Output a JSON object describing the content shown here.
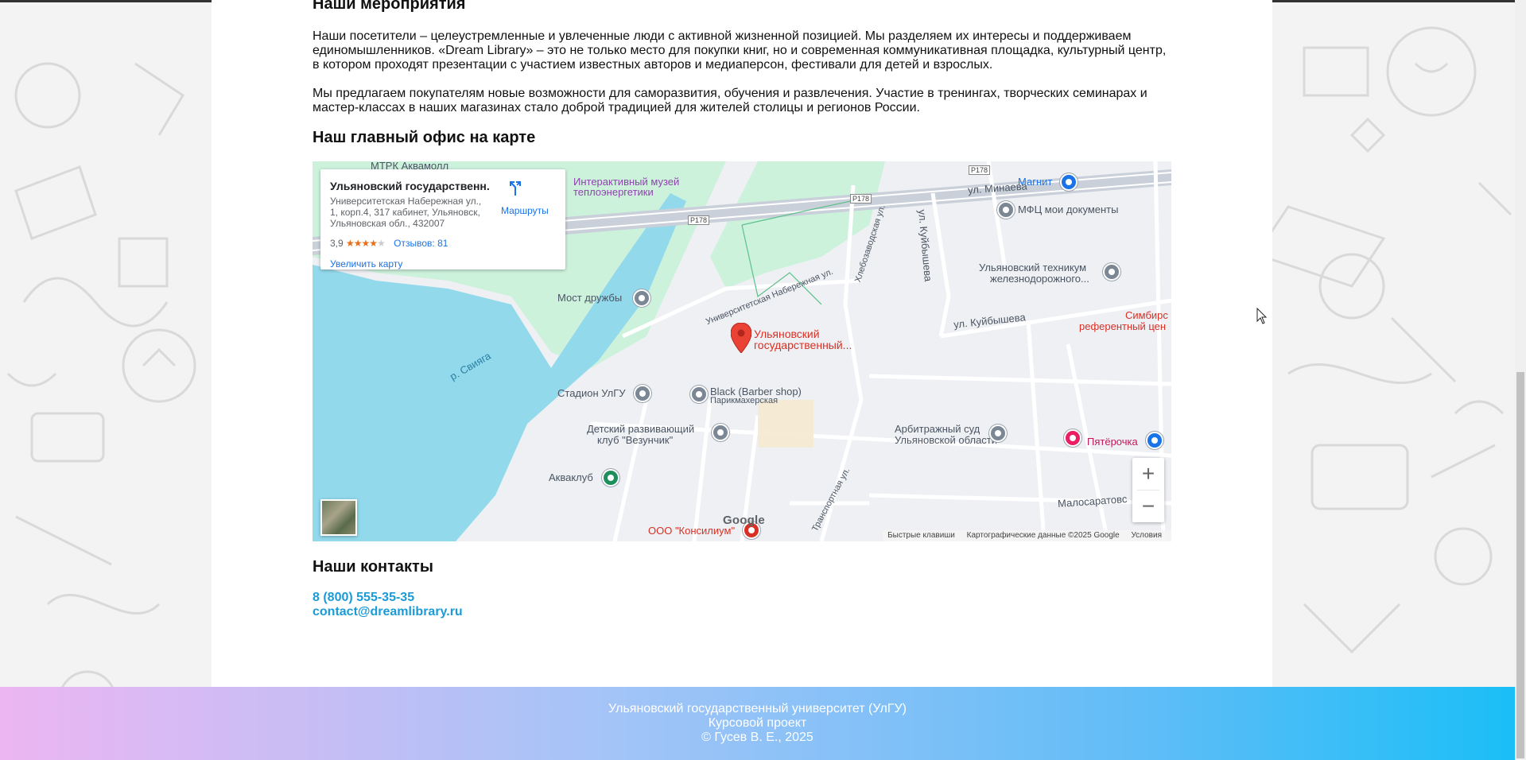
{
  "events": {
    "heading": "Наши мероприятия",
    "paragraph1_line1": "Наши посетители – целеустремленные и увлеченные люди с активной жизненной позицией. Мы разделяем их интересы и поддерживаем",
    "paragraph1_line2": "единомышленников. «Dream Library» – это не только место для покупки книг, но и современная коммуникативная площадка, культурный центр,",
    "paragraph1_line3": "в котором проходят презентации с участием известных авторов и медиаперсон, фестивали для детей и взрослых.",
    "paragraph2_line1": "Мы предлагаем покупателям новые возможности для саморазвития, обучения и развлечения. Участие в тренингах, творческих семинарах и",
    "paragraph2_line2": "мастер-классах в наших магазинах стало доброй традицией для жителей столицы и регионов России."
  },
  "office": {
    "heading": "Наш главный офис на карте"
  },
  "map": {
    "place_title": "Ульяновский государственн...",
    "address_line1": "Университетская Набережная ул.,",
    "address_line2": "1, корп.4, 317 кабинет, Ульяновск,",
    "address_line3": "Ульяновская обл., 432007",
    "rating": "3,9",
    "stars_on": "★★★★",
    "stars_off": "★",
    "reviews": "Отзывов: 81",
    "enlarge": "Увеличить карту",
    "directions": "Маршруты",
    "marker_label_line1": "Ульяновский",
    "marker_label_line2": "государственный...",
    "labels": {
      "akvamoll": "МТРК Аквамолл",
      "museum_line1": "Интерактивный музей",
      "museum_line2": "теплоэнергетики",
      "minaeva": "ул. Минаева",
      "magnit": "Магнит",
      "mfc": "МФЦ мои документы",
      "tech_line1": "Ульяновский техникум",
      "tech_line2": "железнодорожного...",
      "most": "Мост дружбы",
      "kuibysheva1": "ул. Куйбышева",
      "kuibysheva2": "ул. Куйбышева",
      "simbirsk_line1": "Симбирс",
      "simbirsk_line2": "референтный цен",
      "sviyaga": "р. Свияга",
      "univ_nab": "Университетская Набережная ул.",
      "khlebozav": "Хлебозаводская ул.",
      "stadium": "Стадион УлГУ",
      "barber_line1": "Black (Barber shop)",
      "barber_line2": "Парикмахерская",
      "kids_line1": "Детский развивающий",
      "kids_line2": "клуб \"Везунчик\"",
      "arbitr_line1": "Арбитражный суд",
      "arbitr_line2": "Ульяновской области",
      "pyaterochka": "Пятёрочка",
      "akvaklub": "Акваклуб",
      "transport": "Транспортная ул.",
      "malosarat": "Малосаратовс",
      "konsilium": "ООО \"Консилиум\"",
      "r178a": "P178",
      "r178b": "P178",
      "r178c": "P178"
    },
    "google": "Google",
    "footer_shortcuts": "Быстрые клавиши",
    "footer_data": "Картографические данные ©2025 Google",
    "footer_terms": "Условия",
    "zoom_in": "+",
    "zoom_out": "−"
  },
  "contacts": {
    "heading": "Наши контакты",
    "phone": "8 (800) 555-35-35",
    "email": "contact@dreamlibrary.ru"
  },
  "footer": {
    "line1": "Ульяновский государственный университет (УлГУ)",
    "line2": "Курсовой проект",
    "line3": "© Гусев В. Е., 2025"
  },
  "colors": {
    "link": "#1a9bd7",
    "marker": "#ea4335",
    "water": "#8fd3e8",
    "park": "#c8f0d8"
  }
}
